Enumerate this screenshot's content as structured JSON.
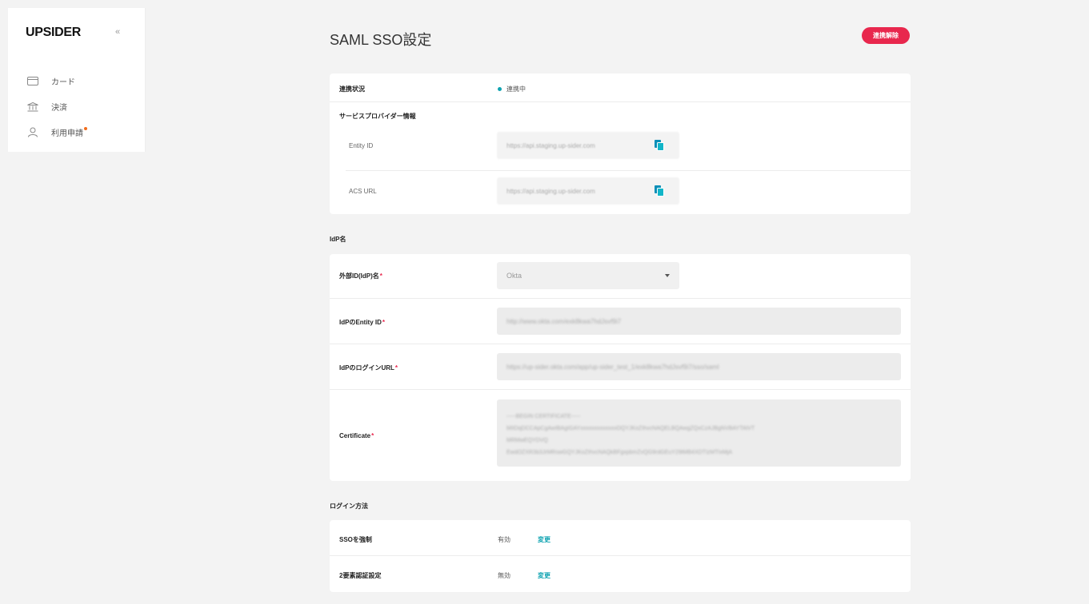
{
  "app": {
    "logo": "UPSIDER",
    "collapse_glyph": "«"
  },
  "sidebar": {
    "items": [
      {
        "label": "カード",
        "icon": "credit-card-icon"
      },
      {
        "label": "決済",
        "icon": "bank-icon"
      },
      {
        "label": "利用申請",
        "icon": "user-icon",
        "has_badge": true
      }
    ]
  },
  "page": {
    "title": "SAML SSO設定",
    "status_button": "連携解除"
  },
  "connection": {
    "status_label": "連携状況",
    "status_value": "連携中",
    "sp_heading": "サービスプロバイダー情報",
    "entity_id_label": "Entity ID",
    "entity_id_value": "https://api.staging.up-sider.com",
    "acs_url_label": "ACS URL",
    "acs_url_value": "https://api.staging.up-sider.com"
  },
  "idp": {
    "section_title": "IdP名",
    "provider_label": "外部ID(IdP)名",
    "provider_value": "Okta",
    "entity_id_label": "IdPのEntity ID",
    "entity_id_value": "http://www.okta.com/exk8kwa7hdJsvf9i7",
    "login_url_label": "IdPのログインURL",
    "login_url_value": "https://up-sider.okta.com/app/up-sider_test_1/exk8kwa7hdJsvf9i7/sso/saml",
    "certificate_label": "Certificate",
    "certificate_lines": [
      "-----BEGIN CERTIFICATE-----",
      "MIIDqDCCApCgAwIBAgIGAYxxxxxxxxxxxxxDQYJKoZIhvcNAQELBQAwgZQxCzAJBgNVBAYTAlVT",
      "MRMwEQYDVQ",
      "EwdOZXR3b3JrMRswGQYJKoZIhvcNAQkBFgxpbmZvQG9rdGEuY29tMB4XDTIzMTIxMjA"
    ]
  },
  "login_method": {
    "section_title": "ログイン方法",
    "rows": [
      {
        "label": "SSOを強制",
        "value": "有効",
        "action": "変更"
      },
      {
        "label": "2要素認証設定",
        "value": "無効",
        "action": "変更"
      }
    ]
  },
  "colors": {
    "accent": "#0fa3b1",
    "danger": "#e8274d",
    "badge": "#f26c1b",
    "background": "#f3f3f3"
  }
}
